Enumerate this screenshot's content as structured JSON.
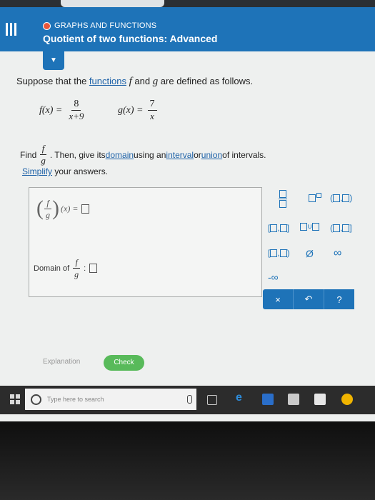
{
  "header": {
    "category": "GRAPHS AND FUNCTIONS",
    "title": "Quotient of two functions: Advanced"
  },
  "problem": {
    "intro_a": "Suppose that the ",
    "intro_link": "functions",
    "intro_b": " and ",
    "intro_c": " are defined as follows.",
    "f_var": "f",
    "g_var": "g",
    "f_lhs": "f(x) =",
    "f_num": "8",
    "f_den": "x+9",
    "g_lhs": "g(x) =",
    "g_num": "7",
    "g_den": "x",
    "find_label": "Find",
    "find_rest_a": ". Then, give its ",
    "find_domain": "domain",
    "find_rest_b": " using an ",
    "find_interval": "interval",
    "find_rest_c": " or ",
    "find_union": "union",
    "find_rest_d": " of intervals.",
    "simplify_link": "Simplify",
    "simplify_rest": " your answers."
  },
  "answer": {
    "expr_x": "(x) =",
    "domain_label": "Domain of"
  },
  "palette": {
    "pow": "□",
    "union": "∪",
    "empty": "Ø",
    "inf": "∞",
    "neginf": "-∞"
  },
  "buttons": {
    "clear": "×",
    "undo": "↶",
    "help": "?",
    "explanation": "Explanation",
    "check": "Check"
  },
  "taskbar": {
    "search_placeholder": "Type here to search"
  }
}
